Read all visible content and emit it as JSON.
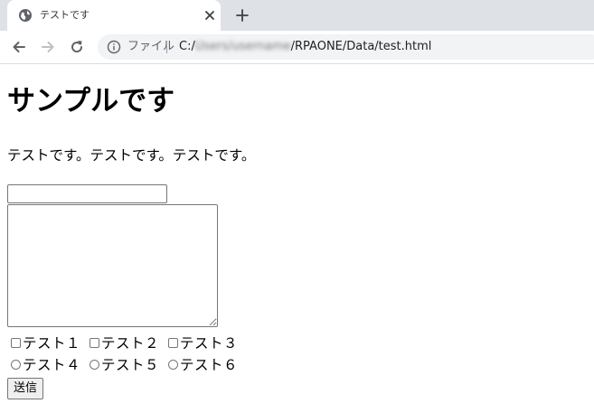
{
  "browser": {
    "tab": {
      "title": "テストです",
      "favicon": "globe-icon",
      "close": "close-icon"
    },
    "new_tab": "plus-icon",
    "nav": {
      "back": "arrow-left-icon",
      "forward": "arrow-right-icon",
      "reload": "reload-icon"
    },
    "address": {
      "info_icon": "info-icon",
      "scheme_label": "ファイル",
      "url_prefix": "C:/",
      "url_redacted": "Users/username",
      "url_suffix": "/RPAONE/Data/test.html"
    }
  },
  "page": {
    "heading": "サンプルです",
    "paragraph": "テストです。テストです。テストです。",
    "text_input": {
      "value": ""
    },
    "textarea": {
      "value": ""
    },
    "checkboxes": [
      {
        "label": "テスト１",
        "checked": false
      },
      {
        "label": "テスト２",
        "checked": false
      },
      {
        "label": "テスト３",
        "checked": false
      }
    ],
    "radios": [
      {
        "label": "テスト４",
        "checked": false
      },
      {
        "label": "テスト５",
        "checked": false
      },
      {
        "label": "テスト６",
        "checked": false
      }
    ],
    "submit_label": "送信"
  },
  "colors": {
    "tabstrip": "#dee1e6",
    "omnibox": "#f1f3f4",
    "icon": "#5f6368",
    "icon_disabled": "#bdc1c6"
  }
}
